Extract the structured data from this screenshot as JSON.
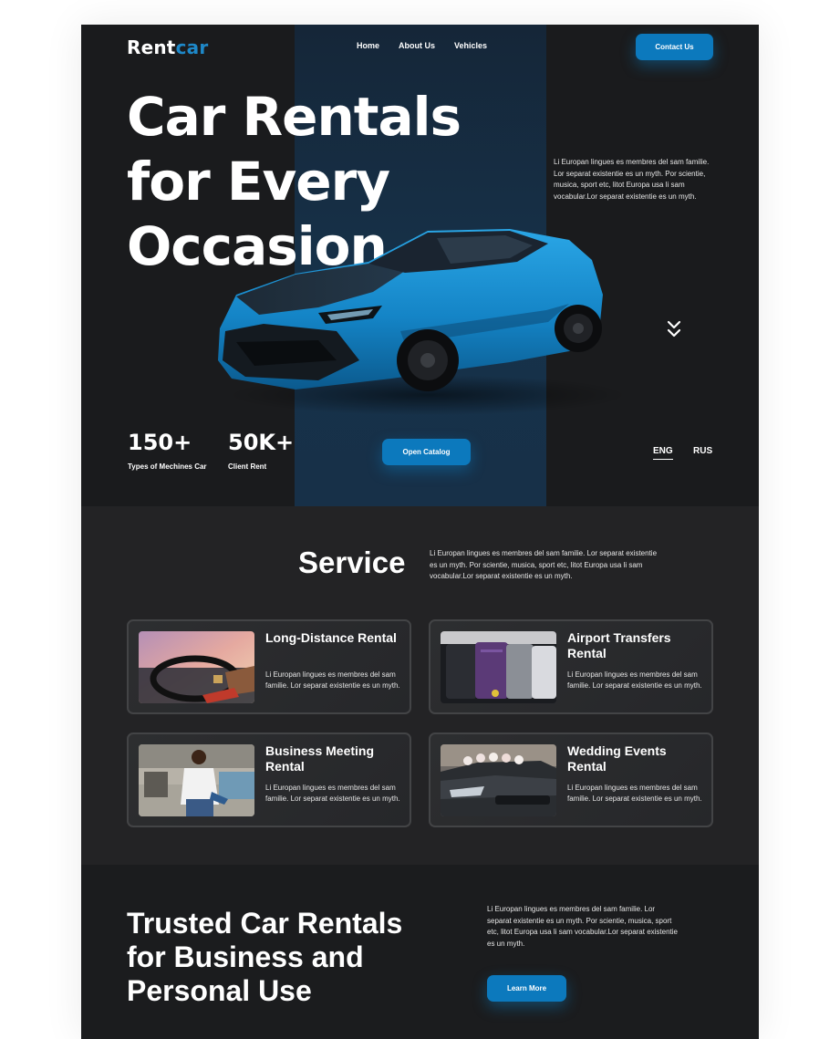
{
  "header": {
    "logo_main": "Rent",
    "logo_accent": "car",
    "nav": [
      "Home",
      "About Us",
      "Vehicles"
    ],
    "contact_label": "Contact Us"
  },
  "hero": {
    "title_line1": "Car Rentals",
    "title_line2": "for Every",
    "title_line3": "Occasion",
    "description": "Li Europan lingues es membres del sam familie. Lor separat existentie es un myth. Por scientie, musica, sport etc, litot Europa usa li sam vocabular.Lor separat existentie es un myth.",
    "stats": [
      {
        "value": "150+",
        "label": "Types of Mechines Car"
      },
      {
        "value": "50K+",
        "label": "Client Rent"
      }
    ],
    "catalog_label": "Open Catalog",
    "languages": [
      "ENG",
      "RUS"
    ],
    "active_language": "ENG"
  },
  "service": {
    "title": "Service",
    "description": "Li Europan lingues es membres del sam familie. Lor separat existentie es un myth. Por scientie, musica, sport etc, litot Europa usa li sam vocabular.Lor separat existentie es un myth.",
    "cards": [
      {
        "title": "Long-Distance Rental",
        "description": "Li Europan lingues es membres del sam familie. Lor separat existentie es un myth.",
        "image": "steering-wheel-photo"
      },
      {
        "title": "Airport Transfers Rental",
        "description": "Li Europan lingues es membres del sam familie. Lor separat existentie es un myth.",
        "image": "luggage-trunk-photo"
      },
      {
        "title": "Business Meeting Rental",
        "description": "Li Europan lingues es membres del sam familie. Lor separat existentie es un myth.",
        "image": "businessman-photo"
      },
      {
        "title": "Wedding Events Rental",
        "description": "Li Europan lingues es membres del sam familie. Lor separat existentie es un myth.",
        "image": "wedding-car-photo"
      }
    ]
  },
  "trusted": {
    "title_line1": "Trusted Car Rentals",
    "title_line2": "for Business and",
    "title_line3": "Personal Use",
    "description": "Li Europan lingues es membres del sam familie. Lor separat existentie es un myth. Por scientie, musica, sport etc, litot Europa usa li sam vocabular.Lor separat existentie es un myth.",
    "button_label": "Learn More"
  },
  "colors": {
    "accent": "#0c79bd",
    "logo_accent": "#1e88c8",
    "background": "#1d1e20",
    "car_body": "#1a8fd1"
  },
  "icons": {
    "scroll": "double-chevron-down-icon"
  }
}
